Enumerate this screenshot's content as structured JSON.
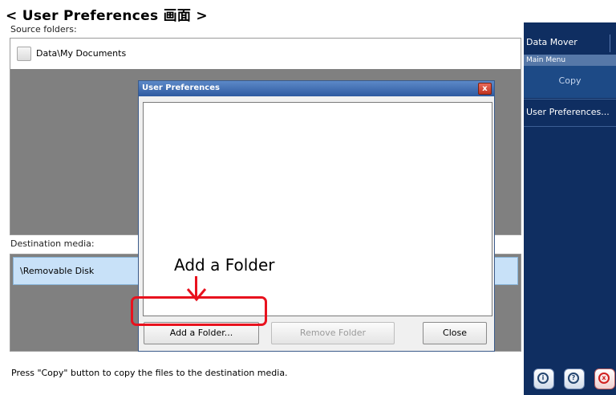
{
  "caption": "< User Preferences 画面 >",
  "source": {
    "label": "Source folders:",
    "items": [
      {
        "label": "Data\\My Documents",
        "checked": false
      }
    ]
  },
  "destination": {
    "label": "Destination media:",
    "items": [
      {
        "label": "\\Removable Disk",
        "selected": true
      }
    ]
  },
  "status_text": "Press \"Copy\" button to copy the files to the destination media.",
  "sidebar": {
    "title": "Data Mover",
    "section": "Main Menu",
    "copy_label": "Copy",
    "preferences_label": "User Preferences...",
    "buttons": [
      {
        "icon": "info-icon",
        "glyph": "i"
      },
      {
        "icon": "help-icon",
        "glyph": "?"
      },
      {
        "icon": "close-icon",
        "glyph": "x"
      }
    ]
  },
  "dialog": {
    "title": "User Preferences",
    "close_glyph": "x",
    "add_folder_label": "Add a Folder...",
    "remove_folder_label": "Remove Folder",
    "close_label": "Close"
  },
  "annotation": {
    "text": "Add a Folder",
    "color": "#e8121e"
  },
  "colors": {
    "sidebar": "#0f2e61",
    "selection": "#c8e1f8",
    "dialog_title": "#2e5aa0"
  }
}
